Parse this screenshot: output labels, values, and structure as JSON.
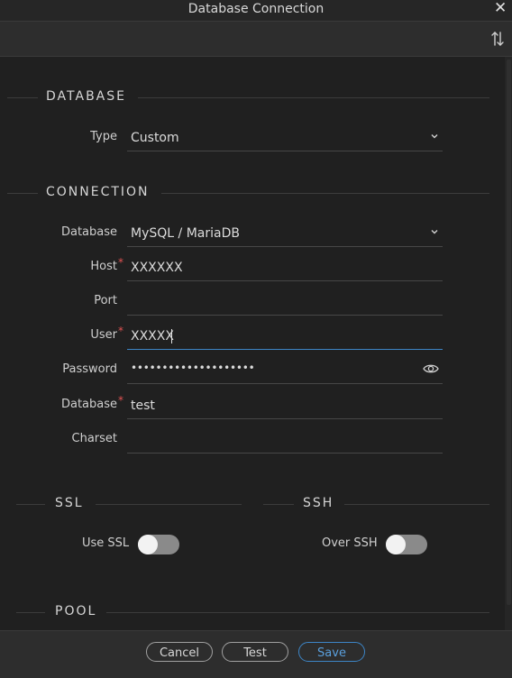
{
  "window": {
    "title": "Database Connection"
  },
  "toolbar": {
    "sort_icon": "sort-arrows-icon"
  },
  "sections": {
    "database": "DATABASE",
    "connection": "CONNECTION",
    "ssl": "SSL",
    "ssh": "SSH",
    "pool": "POOL"
  },
  "database_section": {
    "type_label": "Type",
    "type_value": "Custom"
  },
  "connection_section": {
    "database_label": "Database",
    "database_value": "MySQL / MariaDB",
    "host_label": "Host",
    "host_value": "XXXXXX",
    "port_label": "Port",
    "port_value": "",
    "user_label": "User",
    "user_value": "XXXXX",
    "password_label": "Password",
    "password_value": "••••••••••••••••••••",
    "dbname_label": "Database",
    "dbname_value": "test",
    "charset_label": "Charset",
    "charset_value": "",
    "required_mark": "*"
  },
  "ssl_section": {
    "label": "Use SSL",
    "enabled": false
  },
  "ssh_section": {
    "label": "Over SSH",
    "enabled": false
  },
  "footer": {
    "cancel_label": "Cancel",
    "test_label": "Test",
    "save_label": "Save"
  },
  "colors": {
    "background": "#202020",
    "accent": "#3d85c6",
    "required": "#e05252"
  }
}
